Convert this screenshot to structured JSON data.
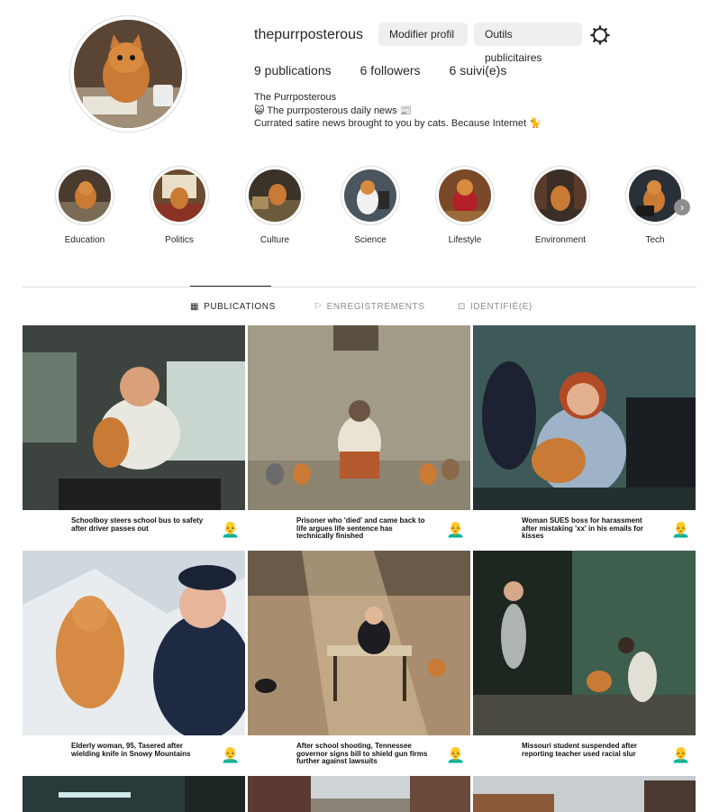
{
  "profile": {
    "username": "thepurrposterous",
    "edit_button": "Modifier profil",
    "tools_button": "Outils publicitaires",
    "stats": {
      "publications": "9 publications",
      "followers": "6 followers",
      "following": "6 suivi(e)s"
    },
    "bio": {
      "name": "The Purrposterous",
      "line1": "😺 The purrposterous daily news 📰",
      "line2": "Currated satire news brought to you by cats. Because Internet 🐈"
    }
  },
  "highlights": [
    {
      "label": "Education"
    },
    {
      "label": "Politics"
    },
    {
      "label": "Culture"
    },
    {
      "label": "Science"
    },
    {
      "label": "Lifestyle"
    },
    {
      "label": "Environment"
    },
    {
      "label": "Tech"
    }
  ],
  "tabs": [
    {
      "label": "PUBLICATIONS",
      "icon": "grid-icon",
      "active": true
    },
    {
      "label": "ENREGISTREMENTS",
      "icon": "bookmark-icon",
      "active": false
    },
    {
      "label": "IDENTIFIÉ(E)",
      "icon": "tag-user-icon",
      "active": false
    }
  ],
  "posts": [
    {
      "caption": "Schoolboy steers school bus to safety after driver passes out",
      "emoji": "👨‍🦲"
    },
    {
      "caption": "Prisoner who 'died' and came back to life argues life sentence has technically finished",
      "emoji": "👨‍🦲"
    },
    {
      "caption": "Woman SUES boss for harassment after mistaking 'xx' in his emails for kisses",
      "emoji": "👨‍🦲"
    },
    {
      "caption": "Elderly woman, 95, Tasered after wielding knife in Snowy Mountains",
      "emoji": "👨‍🦲"
    },
    {
      "caption": "After school shooting, Tennessee governor signs bill to shield gun firms further against lawsuits",
      "emoji": "👨‍🦲"
    },
    {
      "caption": "Missouri student suspended after reporting teacher used racial slur",
      "emoji": "👨‍🦲"
    }
  ]
}
